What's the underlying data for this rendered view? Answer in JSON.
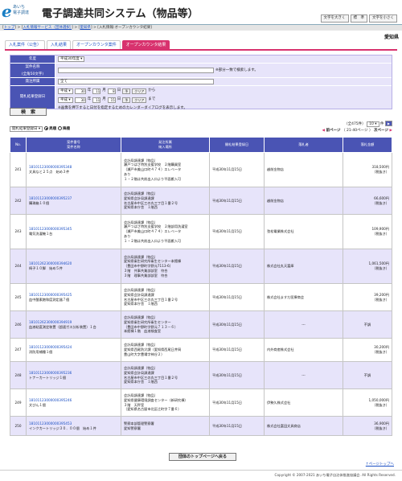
{
  "header": {
    "logo_mark": "e",
    "logo_line1": "あいち",
    "logo_line2": "電子調達",
    "title": "電子調達共同システム（物品等）",
    "font_buttons": [
      "文字を大きく",
      "標　準",
      "文字を小さく"
    ]
  },
  "breadcrumb": {
    "items": [
      "トップ",
      "入札情報サービス（団体選択）",
      "愛知県"
    ],
    "current": "入札情報:オープンカウンタ結果"
  },
  "org_name": "愛知県",
  "tabs": [
    "入札案件（公告）",
    "入札結果",
    "オープンカウンタ案件",
    "オープンカウンタ結果"
  ],
  "search": {
    "year_label": "年度",
    "year_value": "平成30年度",
    "name_label": "案件名称",
    "name_label_sub": "(全角50文字)",
    "name_hint": "※部分一致で検索します。",
    "org_label": "発注所属",
    "org_value": "全て",
    "date_label": "開札結果登録日",
    "date_from": {
      "era": "平成",
      "y": "30",
      "m": "11",
      "d": "8",
      "suffix": "から"
    },
    "date_to": {
      "era": "平成",
      "y": "30",
      "m": "11",
      "d": "15",
      "suffix": "まで"
    },
    "cal_label": "予",
    "clear_label": "クリア",
    "cal_hint": "※画像を押下すると日付を指定するためのカレンダーダイアログを表示します。",
    "button": "検　索"
  },
  "paging": {
    "sort_value": "開札結果登録日",
    "asc_label": "昇順",
    "desc_label": "降順",
    "count": "（全475件）",
    "per_page": "10",
    "per_page_suffix": "件",
    "range": "（ 21-40ページ ）",
    "prev": "前ページ",
    "next": "次ページ"
  },
  "table": {
    "headers": {
      "no": "No.",
      "case_no": "案件番号",
      "case_name": "案件名称",
      "org": "発注所属",
      "place": "納入場所",
      "date": "開札結果登録日",
      "winner": "落札者",
      "amount": "落札金額"
    },
    "rows": [
      {
        "no": "241",
        "code": "18101123000000395348",
        "name": "文具なと２５点　始め３件",
        "org": [
          "会計局調達課（物品）",
          "瀬戸つばさ特別支援学校　２階購買室",
          "（瀬戸市美山口町４７４）エレベータ",
          "あり",
          "１・２階は共前出入口より平面搬入可"
        ],
        "date": "平成30年11月15日",
        "winner": "越前金物店",
        "amount": "318,500円",
        "tax": "（税抜き）"
      },
      {
        "no": "242",
        "code": "18101123000000395237",
        "name": "購珠箱１０個",
        "org": [
          "会計局調達課（物品）",
          "愛知県会計局調達課",
          "名古屋市中区三の丸三丁目１番２号",
          "愛知県本庁舎　１階西"
        ],
        "date": "平成30年11月15日",
        "winner": "越前金物店",
        "amount": "66,600円",
        "tax": "（税抜き）"
      },
      {
        "no": "243",
        "code": "18101123000000395345",
        "name": "電気洗濯機１台",
        "org": [
          "会計局調達課（物品）",
          "瀬戸つばさ特別支援学校　２階部用洗濯室",
          "（瀬戸市美山口町４７４）エレベータ",
          "あり",
          "１・２階は共前出入口より平面搬入可"
        ],
        "date": "平成30年11月15日",
        "winner": "弦松電業株式会社",
        "amount": "109,900円",
        "tax": "（税抜き）"
      },
      {
        "no": "244",
        "code": "18101262300000394620",
        "name": "椅子１０脚　始め５件",
        "org": [
          "会計局調達課（物品）",
          "愛知県衛生研究所衛生センター本館棟",
          "（豊田市中野町字野元7113-6）",
          "３階　共事共業部部室　符合",
          "３階　理事共業部部室　符合"
        ],
        "date": "平成30年11月15日",
        "winner": "株式会社丸天富庫",
        "amount": "1,061,500円",
        "tax": "（税抜き）"
      },
      {
        "no": "245",
        "code": "18101123000000395425",
        "name": "血中酸素飽和度測定器７個",
        "org": [
          "会計局調達課（物品）",
          "愛知県会計局調達課",
          "名古屋市中区三の丸三丁目１番２号",
          "愛知県本庁舎　１階西"
        ],
        "date": "平成30年11月15日",
        "winner": "株式会社ますだ医療商会",
        "amount": "39,200円",
        "tax": "（税抜き）"
      },
      {
        "no": "246",
        "code": "18101262300000394919",
        "name": "血液粘度測定装置（超速ガス分析装置）１台",
        "org": [
          "会計局調達課（物品）",
          "愛知県衛生研究所衛生センター",
          "（豊田市中野町字野元７１３－６）",
          "本館棟１階　血液検査室"
        ],
        "date": "平成30年11月15日",
        "winner": "---",
        "amount": "不調",
        "tax": ""
      },
      {
        "no": "247",
        "code": "18101123000000395424",
        "name": "消防用補種１個",
        "org": [
          "会計局調達課（物品）",
          "愛知県西尾防災課（愛知県西尾日井岡",
          "豊山町大字豊場字神谷２）"
        ],
        "date": "平成30年11月15日",
        "winner": "内外商産株式会社",
        "amount": "30,200円",
        "tax": "（税抜き）"
      },
      {
        "no": "248",
        "code": "18101123000000395236",
        "name": "トナーカートリッジ１個",
        "org": [
          "会計局調達課（物品）",
          "愛知県会計局調達課",
          "名古屋市中区三の丸三丁目１番２号",
          "愛知県本庁舎　１階西"
        ],
        "date": "平成30年11月15日",
        "winner": "---",
        "amount": "不調",
        "tax": ""
      },
      {
        "no": "249",
        "code": "18101123000000395246",
        "name": "文びん１個",
        "org": [
          "会計局調達課（物品）",
          "愛知県健康環境調査センター（新研究棟）",
          "３階　天秤室",
          "（愛知県名古屋市北区辻町字７番６）"
        ],
        "date": "平成30年11月15日",
        "winner": "伊勢久株式会社",
        "amount": "1,050,000円",
        "tax": "（税抜き）"
      },
      {
        "no": "250",
        "code": "18101123000000395453",
        "name": "インクカートリッジ３０．００個　始め１件",
        "org": [
          "警察本部管理警察署",
          "愛知警察署"
        ],
        "date": "平成30年11月15日",
        "winner": "株式会社富田文具商店",
        "amount": "36,900円",
        "tax": "（税抜き）"
      }
    ]
  },
  "to_top_button": "団体のトップページへ戻る",
  "page_top_link": "↑ページトップへ",
  "footer": "Copyright © 2007-2021 あいち電子自治体推進協議会. All Rights Reserved."
}
